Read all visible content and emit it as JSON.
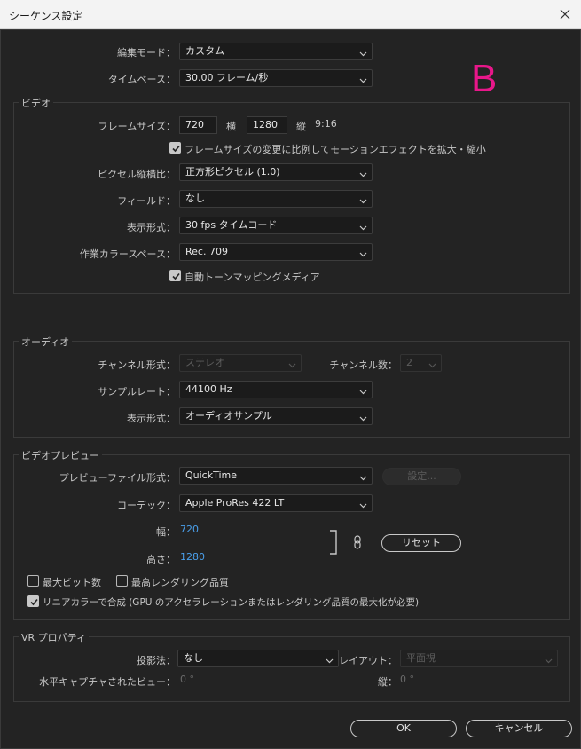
{
  "window": {
    "title": "シーケンス設定"
  },
  "colors": {
    "accent_letter": "#e8178a",
    "link_blue": "#4a9fea"
  },
  "overlay_letter": "B",
  "top": {
    "edit_mode_label": "編集モード：",
    "edit_mode_value": "カスタム",
    "timebase_label": "タイムベース：",
    "timebase_value": "30.00  フレーム/秒"
  },
  "video": {
    "section_title": "ビデオ",
    "frame_size_label": "フレームサイズ：",
    "width_value": "720",
    "horiz_label": "横",
    "height_value": "1280",
    "vert_label": "縦",
    "aspect_text": "9:16",
    "scale_checkbox_label": "フレームサイズの変更に比例してモーションエフェクトを拡大・縮小",
    "pixel_aspect_label": "ピクセル縦横比：",
    "pixel_aspect_value": "正方形ピクセル (1.0)",
    "field_label": "フィールド：",
    "field_value": "なし",
    "display_format_label": "表示形式：",
    "display_format_value": "30 fps タイムコード",
    "color_space_label": "作業カラースペース：",
    "color_space_value": "Rec. 709",
    "tonemap_label": "自動トーンマッピングメディア"
  },
  "audio": {
    "section_title": "オーディオ",
    "channel_format_label": "チャンネル形式：",
    "channel_format_value": "ステレオ",
    "channel_count_label": "チャンネル数：",
    "channel_count_value": "2",
    "sample_rate_label": "サンプルレート：",
    "sample_rate_value": "44100 Hz",
    "display_format_label": "表示形式：",
    "display_format_value": "オーディオサンプル"
  },
  "preview": {
    "section_title": "ビデオプレビュー",
    "file_format_label": "プレビューファイル形式：",
    "file_format_value": "QuickTime",
    "settings_button": "設定...",
    "codec_label": "コーデック：",
    "codec_value": "Apple ProRes 422 LT",
    "width_label": "幅：",
    "width_value": "720",
    "height_label": "高さ：",
    "height_value": "1280",
    "reset_button": "リセット",
    "max_bit_depth_label": "最大ビット数",
    "max_render_label": "最高レンダリング品質",
    "linear_color_label": "リニアカラーで合成 (GPU のアクセラレーションまたはレンダリング品質の最大化が必要)"
  },
  "vr": {
    "section_title": "VR プロパティ",
    "projection_label": "投影法：",
    "projection_value": "なし",
    "layout_label": "レイアウト：",
    "layout_value": "平面視",
    "captured_view_label": "水平キャプチャされたビュー：",
    "captured_view_value": "0 °",
    "vertical_label": "縦：",
    "vertical_value": "0 °"
  },
  "footer": {
    "ok_button": "OK",
    "cancel_button": "キャンセル"
  }
}
